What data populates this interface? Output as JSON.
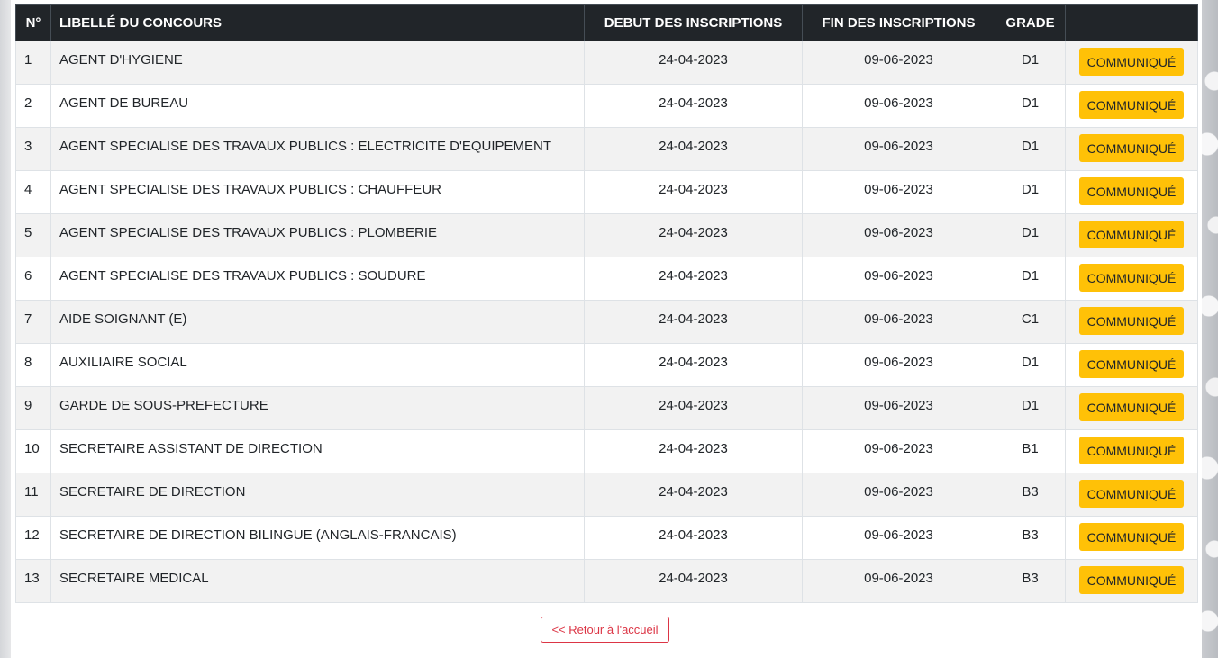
{
  "table": {
    "headers": [
      "N°",
      "LIBELLÉ DU CONCOURS",
      "DEBUT DES INSCRIPTIONS",
      "FIN DES INSCRIPTIONS",
      "GRADE",
      ""
    ],
    "rows": [
      {
        "num": "1",
        "label": "AGENT D'HYGIENE",
        "start": "24-04-2023",
        "end": "09-06-2023",
        "grade": "D1",
        "action": "COMMUNIQUÉ"
      },
      {
        "num": "2",
        "label": "AGENT DE BUREAU",
        "start": "24-04-2023",
        "end": "09-06-2023",
        "grade": "D1",
        "action": "COMMUNIQUÉ"
      },
      {
        "num": "3",
        "label": "AGENT SPECIALISE DES TRAVAUX PUBLICS : ELECTRICITE D'EQUIPEMENT",
        "start": "24-04-2023",
        "end": "09-06-2023",
        "grade": "D1",
        "action": "COMMUNIQUÉ"
      },
      {
        "num": "4",
        "label": "AGENT SPECIALISE DES TRAVAUX PUBLICS : CHAUFFEUR",
        "start": "24-04-2023",
        "end": "09-06-2023",
        "grade": "D1",
        "action": "COMMUNIQUÉ"
      },
      {
        "num": "5",
        "label": "AGENT SPECIALISE DES TRAVAUX PUBLICS : PLOMBERIE",
        "start": "24-04-2023",
        "end": "09-06-2023",
        "grade": "D1",
        "action": "COMMUNIQUÉ"
      },
      {
        "num": "6",
        "label": "AGENT SPECIALISE DES TRAVAUX PUBLICS : SOUDURE",
        "start": "24-04-2023",
        "end": "09-06-2023",
        "grade": "D1",
        "action": "COMMUNIQUÉ"
      },
      {
        "num": "7",
        "label": "AIDE SOIGNANT (E)",
        "start": "24-04-2023",
        "end": "09-06-2023",
        "grade": "C1",
        "action": "COMMUNIQUÉ"
      },
      {
        "num": "8",
        "label": "AUXILIAIRE SOCIAL",
        "start": "24-04-2023",
        "end": "09-06-2023",
        "grade": "D1",
        "action": "COMMUNIQUÉ"
      },
      {
        "num": "9",
        "label": "GARDE DE SOUS-PREFECTURE",
        "start": "24-04-2023",
        "end": "09-06-2023",
        "grade": "D1",
        "action": "COMMUNIQUÉ"
      },
      {
        "num": "10",
        "label": "SECRETAIRE ASSISTANT DE DIRECTION",
        "start": "24-04-2023",
        "end": "09-06-2023",
        "grade": "B1",
        "action": "COMMUNIQUÉ"
      },
      {
        "num": "11",
        "label": "SECRETAIRE DE DIRECTION",
        "start": "24-04-2023",
        "end": "09-06-2023",
        "grade": "B3",
        "action": "COMMUNIQUÉ"
      },
      {
        "num": "12",
        "label": "SECRETAIRE DE DIRECTION BILINGUE (ANGLAIS-FRANCAIS)",
        "start": "24-04-2023",
        "end": "09-06-2023",
        "grade": "B3",
        "action": "COMMUNIQUÉ"
      },
      {
        "num": "13",
        "label": "SECRETAIRE MEDICAL",
        "start": "24-04-2023",
        "end": "09-06-2023",
        "grade": "B3",
        "action": "COMMUNIQUÉ"
      }
    ]
  },
  "footer": {
    "back_label": "<< Retour à l'accueil"
  },
  "colors": {
    "header_bg": "#212529",
    "button_warning": "#ffc107",
    "back_button_danger": "#dc3545",
    "row_stripe": "#f2f2f2"
  }
}
